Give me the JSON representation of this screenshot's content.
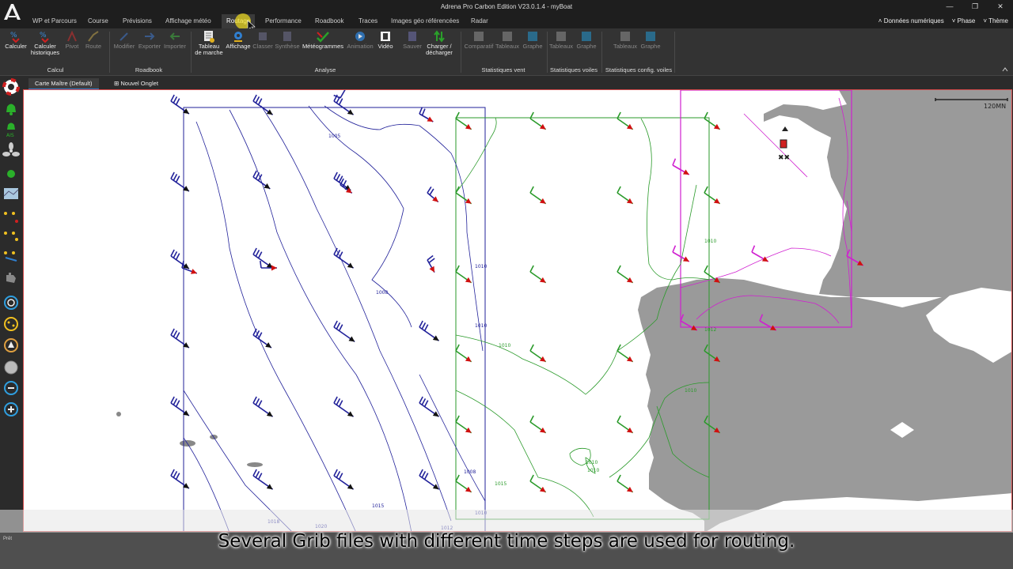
{
  "window": {
    "title": "Adrena Pro Carbon Edition V23.0.1.4 - myBoat"
  },
  "tabs": [
    {
      "label": "WP et Parcours"
    },
    {
      "label": "Course"
    },
    {
      "label": "Prévisions"
    },
    {
      "label": "Affichage météo"
    },
    {
      "label": "Routage"
    },
    {
      "label": "Performance"
    },
    {
      "label": "Roadbook"
    },
    {
      "label": "Traces"
    },
    {
      "label": "Images géo référencées"
    },
    {
      "label": "Radar"
    }
  ],
  "right_menus": [
    {
      "label": "Données numériques"
    },
    {
      "label": "Phase"
    },
    {
      "label": "Thème"
    }
  ],
  "ribbon": {
    "buttons": [
      {
        "label": "Calculer"
      },
      {
        "label": "Calculer historiques"
      },
      {
        "label": "Pivot"
      },
      {
        "label": "Route"
      },
      {
        "label": "Modifier"
      },
      {
        "label": "Exporter"
      },
      {
        "label": "Importer"
      },
      {
        "label": "Tableau de marche"
      },
      {
        "label": "Affichage"
      },
      {
        "label": "Classer"
      },
      {
        "label": "Synthèse"
      },
      {
        "label": "Météogrammes"
      },
      {
        "label": "Animation"
      },
      {
        "label": "Vidéo"
      },
      {
        "label": "Sauver"
      },
      {
        "label": "Charger / décharger"
      },
      {
        "label": "Comparatif"
      },
      {
        "label": "Tableaux"
      },
      {
        "label": "Graphe"
      },
      {
        "label": "Tableaux"
      },
      {
        "label": "Graphe"
      },
      {
        "label": "Tableaux"
      },
      {
        "label": "Graphe"
      }
    ],
    "groups": [
      {
        "label": "Calcul"
      },
      {
        "label": "Roadbook"
      },
      {
        "label": "Analyse"
      },
      {
        "label": "Statistiques vent"
      },
      {
        "label": "Statistiques voiles"
      },
      {
        "label": "Statistiques config. voiles"
      }
    ]
  },
  "map_tabs": [
    {
      "label": "Carte Maître (Default)"
    },
    {
      "label": "Nouvel Onglet"
    }
  ],
  "map": {
    "scale_label": "120MN",
    "isobar_labels": [
      "1005",
      "1008",
      "1010",
      "1010",
      "1008",
      "1010",
      "1012",
      "1015",
      "1018",
      "1020",
      "1010",
      "1010",
      "1010",
      "1010",
      "1012",
      "1010",
      "1015"
    ],
    "colors": {
      "grib1": "#22229a",
      "grib2": "#2a9a2a",
      "grib3": "#d020d0",
      "land": "#9a9a9a",
      "arrow": "#d01010"
    }
  },
  "status": {
    "text": "Prêt"
  },
  "caption": "Several Grib files with different time steps are used for routing."
}
